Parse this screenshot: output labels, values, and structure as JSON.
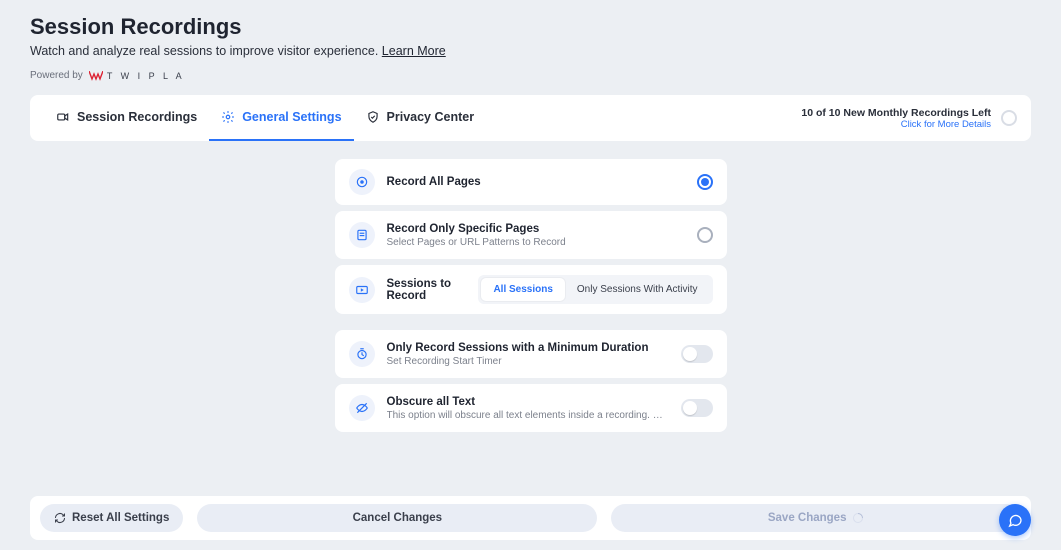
{
  "header": {
    "title": "Session Recordings",
    "subtitle_text": "Watch and analyze real sessions to improve visitor experience. ",
    "learn_more": "Learn More",
    "powered_by": "Powered by",
    "brand": "T W I P L A"
  },
  "tabs": {
    "recordings": "Session Recordings",
    "general": "General Settings",
    "privacy": "Privacy Center",
    "quota_title": "10 of 10 New Monthly Recordings Left",
    "quota_link": "Click for More Details"
  },
  "settings": {
    "record_all": {
      "title": "Record All Pages"
    },
    "record_specific": {
      "title": "Record Only Specific Pages",
      "desc": "Select Pages or URL Patterns to Record"
    },
    "sessions": {
      "title": "Sessions to Record",
      "opt_all": "All Sessions",
      "opt_activity": "Only Sessions With Activity"
    },
    "min_duration": {
      "title": "Only Record Sessions with a Minimum Duration",
      "desc": "Set Recording Start Timer"
    },
    "obscure": {
      "title": "Obscure all Text",
      "desc": "This option will obscure all text elements inside a recording. Please note that pre…"
    }
  },
  "footer": {
    "reset": "Reset All Settings",
    "cancel": "Cancel Changes",
    "save": "Save Changes"
  }
}
